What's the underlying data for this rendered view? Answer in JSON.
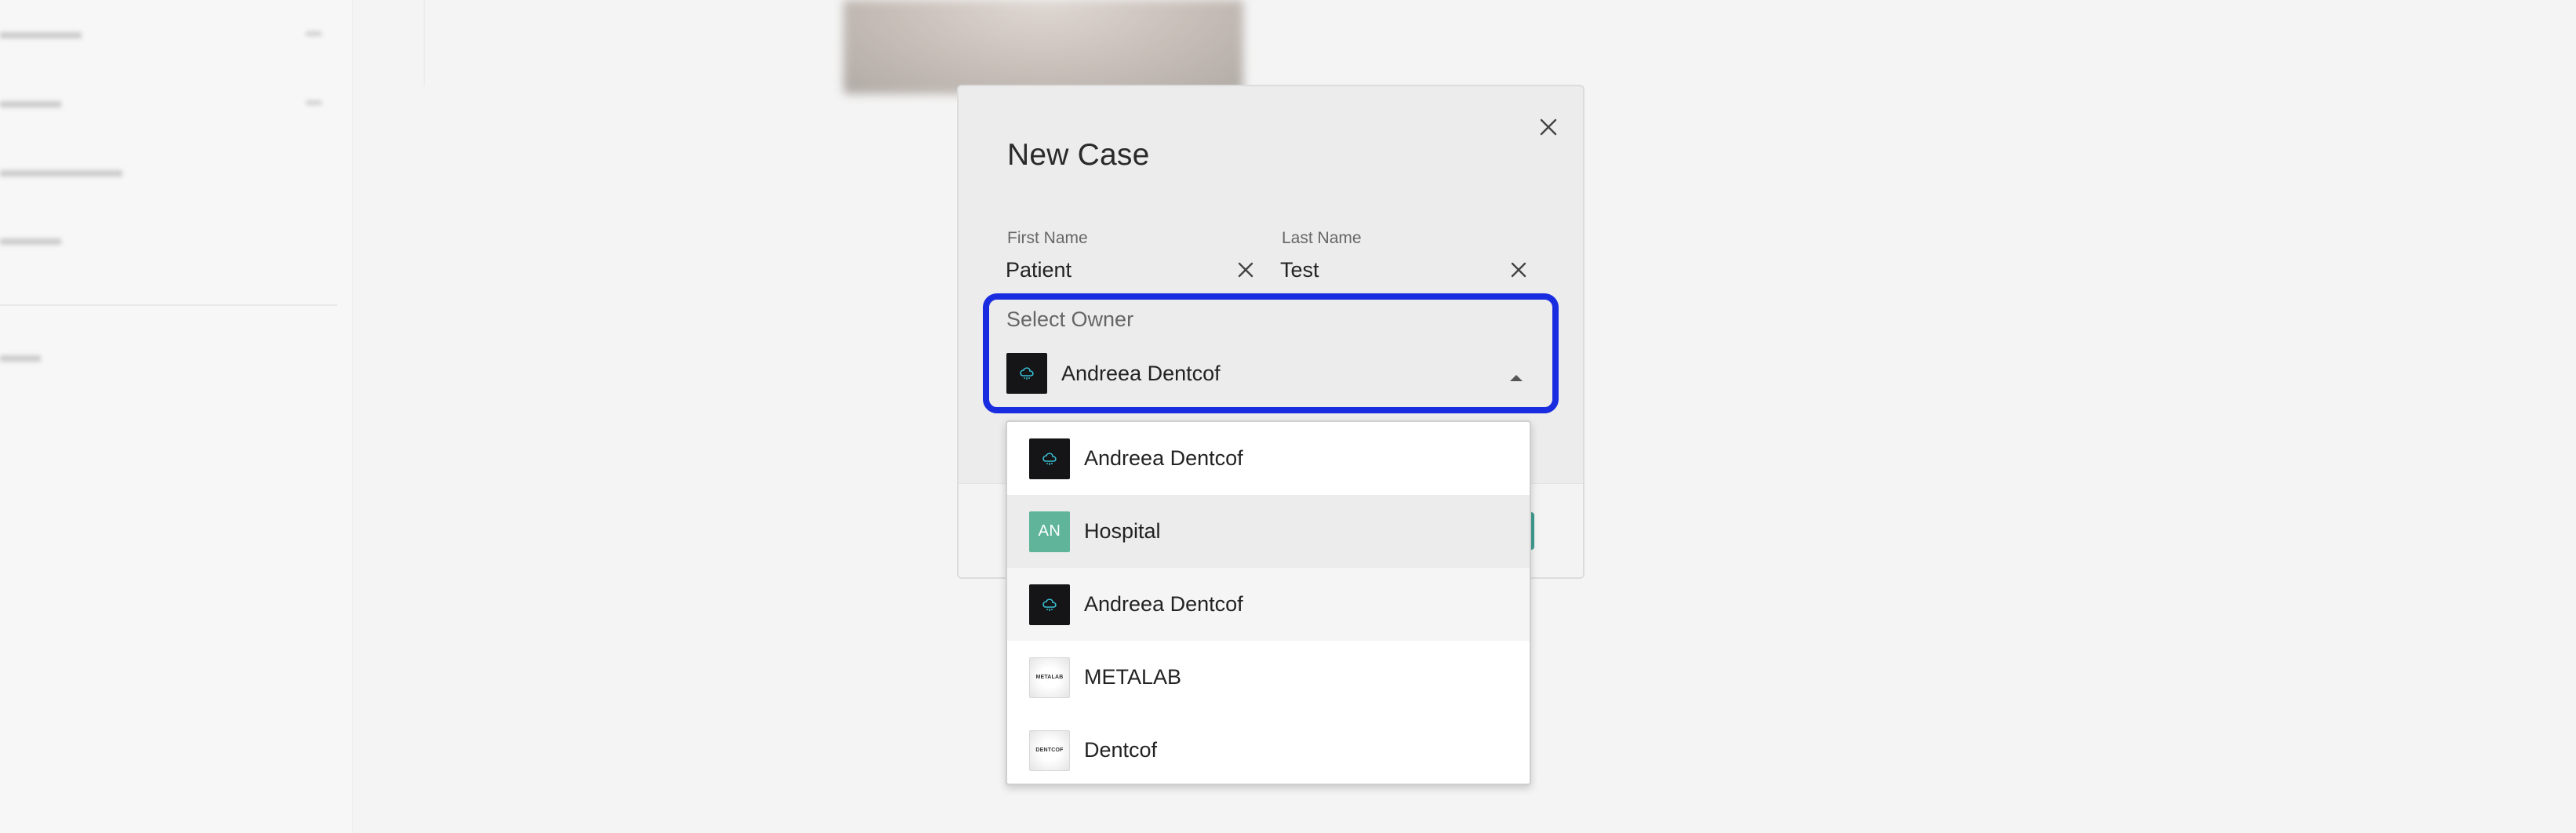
{
  "modal": {
    "title": "New Case",
    "close_icon": "close-icon",
    "first_name": {
      "label": "First Name",
      "value": "Patient",
      "clear_icon": "clear-icon"
    },
    "last_name": {
      "label": "Last Name",
      "value": "Test",
      "clear_icon": "clear-icon"
    },
    "owner": {
      "label": "Select Owner",
      "selected": "Andreea Dentcof",
      "caret_icon": "caret-up-icon"
    }
  },
  "dropdown": {
    "options": [
      {
        "label": "Andreea Dentcof",
        "avatar": "dark-logo",
        "state": ""
      },
      {
        "label": "Hospital",
        "avatar": "initials",
        "initials": "AN",
        "state": "hover"
      },
      {
        "label": "Andreea Dentcof",
        "avatar": "dark-logo",
        "state": "selected"
      },
      {
        "label": "METALAB",
        "avatar": "brand-logo",
        "logo_text": "METALAB",
        "state": ""
      },
      {
        "label": "Dentcof",
        "avatar": "brand-logo",
        "logo_text": "DENTCOF",
        "state": ""
      }
    ]
  },
  "colors": {
    "highlight": "#1a2ce0",
    "avatar_dark": "#151517",
    "avatar_teal": "#5fb49a",
    "logo_cyan": "#39c0d4",
    "primary_button": "#3f9d90"
  }
}
